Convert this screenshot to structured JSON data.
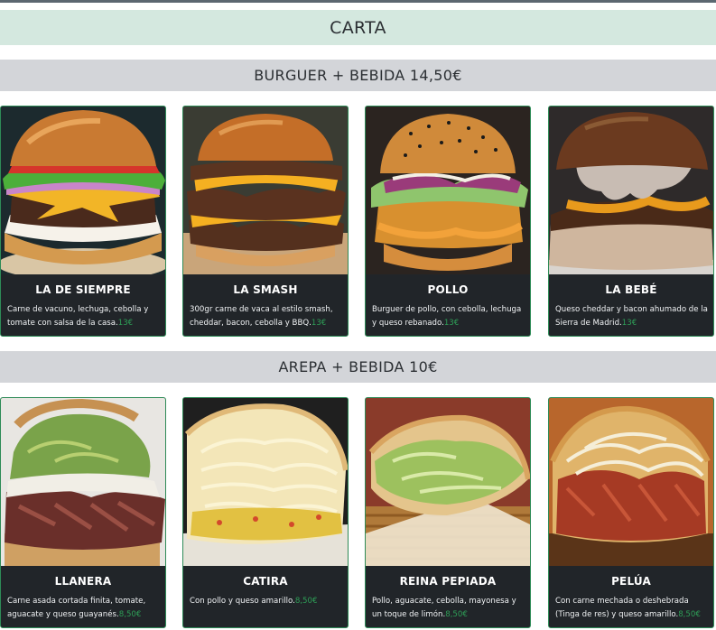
{
  "header": {
    "title": "CARTA"
  },
  "colors": {
    "card_bg": "#212529",
    "card_border": "#2e8b57",
    "price": "#2e9e57",
    "carta_bg": "#d4e8df",
    "section_bg": "#d3d5d9"
  },
  "sections": [
    {
      "title": "BURGUER + BEBIDA 14,50€",
      "items": [
        {
          "name": "LA DE SIEMPRE",
          "description": "Carne de vacuno, lechuga, cebolla y tomate con salsa de la casa.",
          "price": "13€",
          "image": "classic-burger-photo"
        },
        {
          "name": "LA SMASH",
          "description": "300gr carne de vaca al estilo smash, cheddar, bacon, cebolla y BBQ.",
          "price": "13€",
          "image": "smash-burger-photo"
        },
        {
          "name": "POLLO",
          "description": "Burguer de pollo, con cebolla, lechuga y queso rebanado.",
          "price": "13€",
          "image": "chicken-burger-photo"
        },
        {
          "name": "LA BEBÉ",
          "description": "Queso cheddar y bacon ahumado de la Sierra de Madrid.",
          "price": "13€",
          "image": "bacon-cheese-burger-photo"
        }
      ]
    },
    {
      "title": "AREPA + BEBIDA 10€",
      "items": [
        {
          "name": "LLANERA",
          "description": "Carne asada cortada finita, tomate, aguacate y queso guayanés.",
          "price": "8,50€",
          "image": "llanera-arepa-photo"
        },
        {
          "name": "CATIRA",
          "description": "Con pollo y queso amarillo.",
          "price": "8,50€",
          "image": "catira-arepa-photo"
        },
        {
          "name": "REINA PEPIADA",
          "description": "Pollo, aguacate, cebolla, mayonesa y un toque de limón.",
          "price": "8,50€",
          "image": "reina-pepiada-arepa-photo"
        },
        {
          "name": "PELÚA",
          "description": "Con carne mechada o deshebrada (Tinga de res) y queso amarillo.",
          "price": "8,50€",
          "image": "pelua-arepa-photo"
        }
      ]
    }
  ]
}
